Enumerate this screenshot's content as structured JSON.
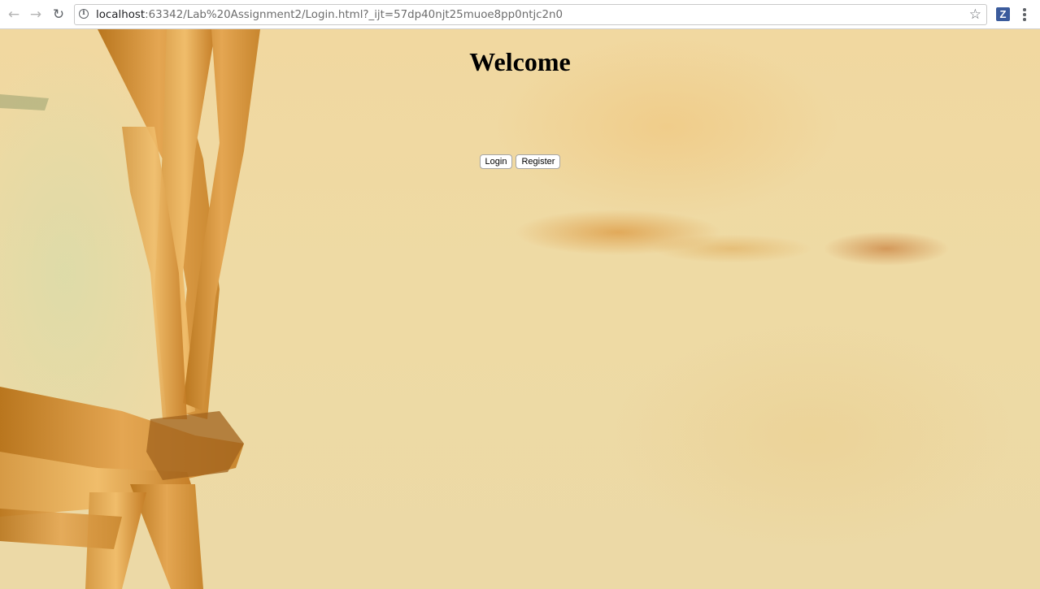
{
  "browser": {
    "url_host": "localhost",
    "url_rest": ":63342/Lab%20Assignment2/Login.html?_ijt=57dp40njt25muoe8pp0ntjc2n0",
    "extension_letter": "Z",
    "icons": {
      "back": "arrow-left-icon",
      "forward": "arrow-right-icon",
      "reload": "reload-icon",
      "info": "info-icon",
      "bookmark": "star-icon",
      "extension": "zotero-icon",
      "menu": "kebab-menu-icon"
    },
    "accent_color": "#3b5b9c"
  },
  "page": {
    "heading": "Welcome",
    "login_label": "Login",
    "register_label": "Register",
    "background_colors": [
      "#f1d8a0",
      "#d6821e",
      "#c98a3a"
    ]
  }
}
